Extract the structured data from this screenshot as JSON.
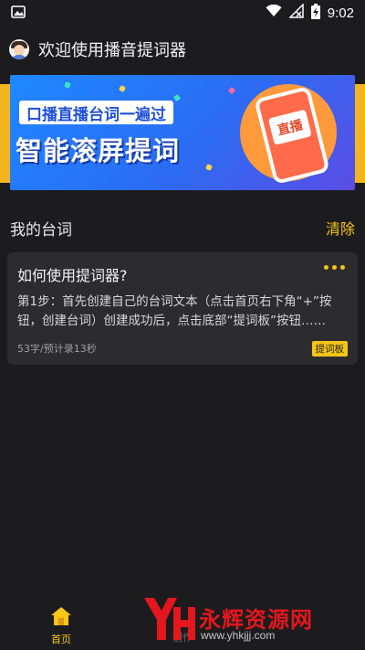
{
  "status_bar": {
    "time": "9:02"
  },
  "header": {
    "title": "欢迎使用播音提词器"
  },
  "banner": {
    "subtitle": "口播直播台词一遍过",
    "headline": "智能滚屏提词",
    "phone_text": "直播"
  },
  "section": {
    "title": "我的台词",
    "clear_label": "清除"
  },
  "scripts": [
    {
      "title": "如何使用提词器?",
      "body": "第1步：首先创建自己的台词文本（点击首页右下角“+”按钮，创建台词）创建成功后，点击底部“提词板”按钮……",
      "meta": "53字/预计录13秒",
      "tag": "提词板"
    }
  ],
  "nav": {
    "home_label": "首页",
    "create_label": "创作"
  },
  "watermark": {
    "brand": "永辉资源网",
    "url": "www.yhkjjj.com"
  },
  "colors": {
    "background": "#1c1c1e",
    "accent": "#f5c518",
    "card": "#2c2c2e"
  }
}
